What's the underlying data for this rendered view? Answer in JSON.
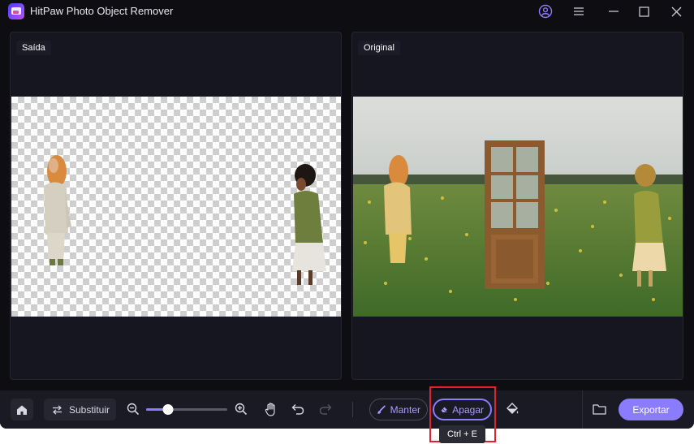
{
  "window": {
    "title": "HitPaw Photo Object Remover"
  },
  "panels": {
    "output_label": "Saída",
    "original_label": "Original"
  },
  "toolbar": {
    "replace_label": "Substituir",
    "keep_label": "Manter",
    "erase_label": "Apagar",
    "export_label": "Exportar",
    "zoom_level": 0.27
  },
  "tooltip": {
    "shortcut": "Ctrl + E"
  },
  "colors": {
    "accent": "#8b7bff",
    "highlight_box": "#e8202a",
    "app_background": "#0d0d12"
  },
  "icons": {
    "titlebar": [
      "account-icon",
      "menu-icon",
      "minimize-icon",
      "maximize-icon",
      "close-icon"
    ],
    "toolbar": [
      "home-icon",
      "swap-icon",
      "zoom-out-icon",
      "zoom-in-icon",
      "hand-icon",
      "undo-icon",
      "redo-icon",
      "brush-icon",
      "eraser-icon",
      "paint-bucket-icon",
      "folder-icon"
    ]
  }
}
